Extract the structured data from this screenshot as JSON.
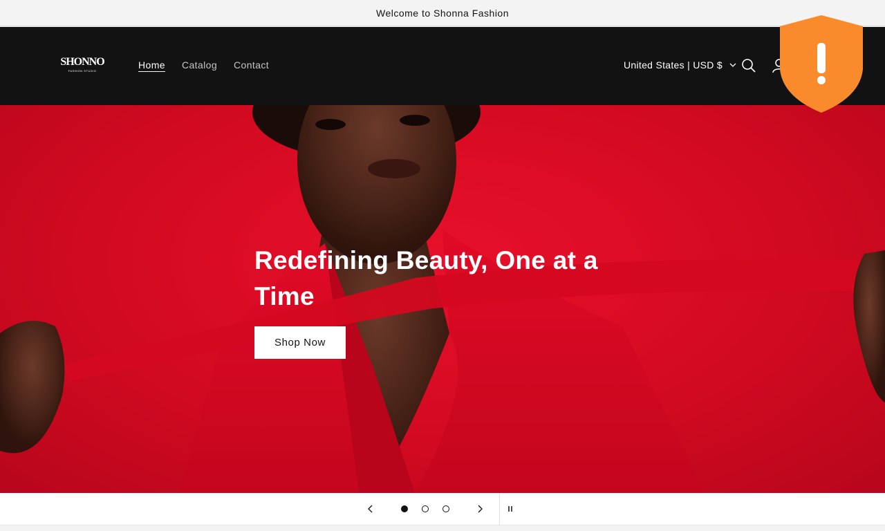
{
  "announcement": {
    "text": "Welcome to Shonna Fashion"
  },
  "header": {
    "logo": {
      "mark": "SHONNO",
      "subtitle": "FASHION STUDIO"
    },
    "nav": [
      {
        "label": "Home",
        "active": true
      },
      {
        "label": "Catalog",
        "active": false
      },
      {
        "label": "Contact",
        "active": false
      }
    ],
    "currency_selector": {
      "value": "United States | USD $"
    },
    "icons": {
      "search": "search-icon",
      "account": "account-icon"
    }
  },
  "hero": {
    "title": "Redefining Beauty, One at a Time",
    "button_label": "Shop Now",
    "background_color": "#d20a21"
  },
  "slideshow": {
    "slides_total": 3,
    "current_slide": 1,
    "icons": {
      "previous": "chevron-left-icon",
      "next": "chevron-right-icon",
      "pause": "pause-icon"
    }
  },
  "overlay_badge": {
    "icon": "warning-shield-icon",
    "color": "#f98b2c"
  },
  "colors": {
    "header_bg": "#121212",
    "announcement_bg": "#f3f3f3",
    "accent": "#d20a21"
  }
}
